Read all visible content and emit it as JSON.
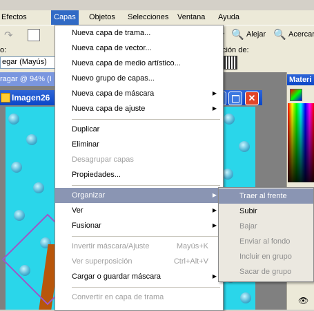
{
  "menubar": {
    "items": [
      "Efectos",
      "Capas",
      "Objetos",
      "Selecciones",
      "Ventana",
      "Ayuda"
    ],
    "active": "Capas"
  },
  "toolbar": {
    "zoom_out_label": "Alejar",
    "zoom_in_label": "Acercar"
  },
  "options": {
    "row1_label": "o:",
    "row1_right_label": "ción de:",
    "mode_value": "egar (Mayús)"
  },
  "image_window": {
    "title": "Imagen26",
    "behind_title": "ragar @ 94% (I"
  },
  "materials": {
    "title": "Materi"
  },
  "layers_menu": {
    "items": [
      {
        "label": "Nueva capa de trama...",
        "shortcut": "",
        "arrow": false,
        "disabled": false
      },
      {
        "label": "Nueva capa de vector...",
        "shortcut": "",
        "arrow": false,
        "disabled": false
      },
      {
        "label": "Nueva capa de medio artístico...",
        "shortcut": "",
        "arrow": false,
        "disabled": false
      },
      {
        "label": "Nuevo grupo de capas...",
        "shortcut": "",
        "arrow": false,
        "disabled": false
      },
      {
        "label": "Nueva capa de máscara",
        "shortcut": "",
        "arrow": true,
        "disabled": false
      },
      {
        "label": "Nueva capa de ajuste",
        "shortcut": "",
        "arrow": true,
        "disabled": false
      },
      {
        "label": "Duplicar",
        "shortcut": "",
        "arrow": false,
        "disabled": false
      },
      {
        "label": "Eliminar",
        "shortcut": "",
        "arrow": false,
        "disabled": false
      },
      {
        "label": "Desagrupar capas",
        "shortcut": "",
        "arrow": false,
        "disabled": true
      },
      {
        "label": "Propiedades...",
        "shortcut": "",
        "arrow": false,
        "disabled": false
      },
      {
        "label": "Organizar",
        "shortcut": "",
        "arrow": true,
        "disabled": false,
        "highlighted": true
      },
      {
        "label": "Ver",
        "shortcut": "",
        "arrow": true,
        "disabled": false
      },
      {
        "label": "Fusionar",
        "shortcut": "",
        "arrow": true,
        "disabled": false
      },
      {
        "label": "Invertir máscara/Ajuste",
        "shortcut": "Mayús+K",
        "arrow": false,
        "disabled": true
      },
      {
        "label": "Ver superposición",
        "shortcut": "Ctrl+Alt+V",
        "arrow": false,
        "disabled": true
      },
      {
        "label": "Cargar o guardar máscara",
        "shortcut": "",
        "arrow": true,
        "disabled": false
      },
      {
        "label": "Convertir en capa de trama",
        "shortcut": "",
        "arrow": false,
        "disabled": true
      }
    ]
  },
  "arrange_submenu": {
    "items": [
      {
        "label": "Traer al frente",
        "disabled": false,
        "highlighted": true
      },
      {
        "label": "Subir",
        "disabled": false
      },
      {
        "label": "Bajar",
        "disabled": true
      },
      {
        "label": "Enviar al fondo",
        "disabled": true
      },
      {
        "label": "Incluir en grupo",
        "disabled": true
      },
      {
        "label": "Sacar de grupo",
        "disabled": true
      }
    ]
  }
}
